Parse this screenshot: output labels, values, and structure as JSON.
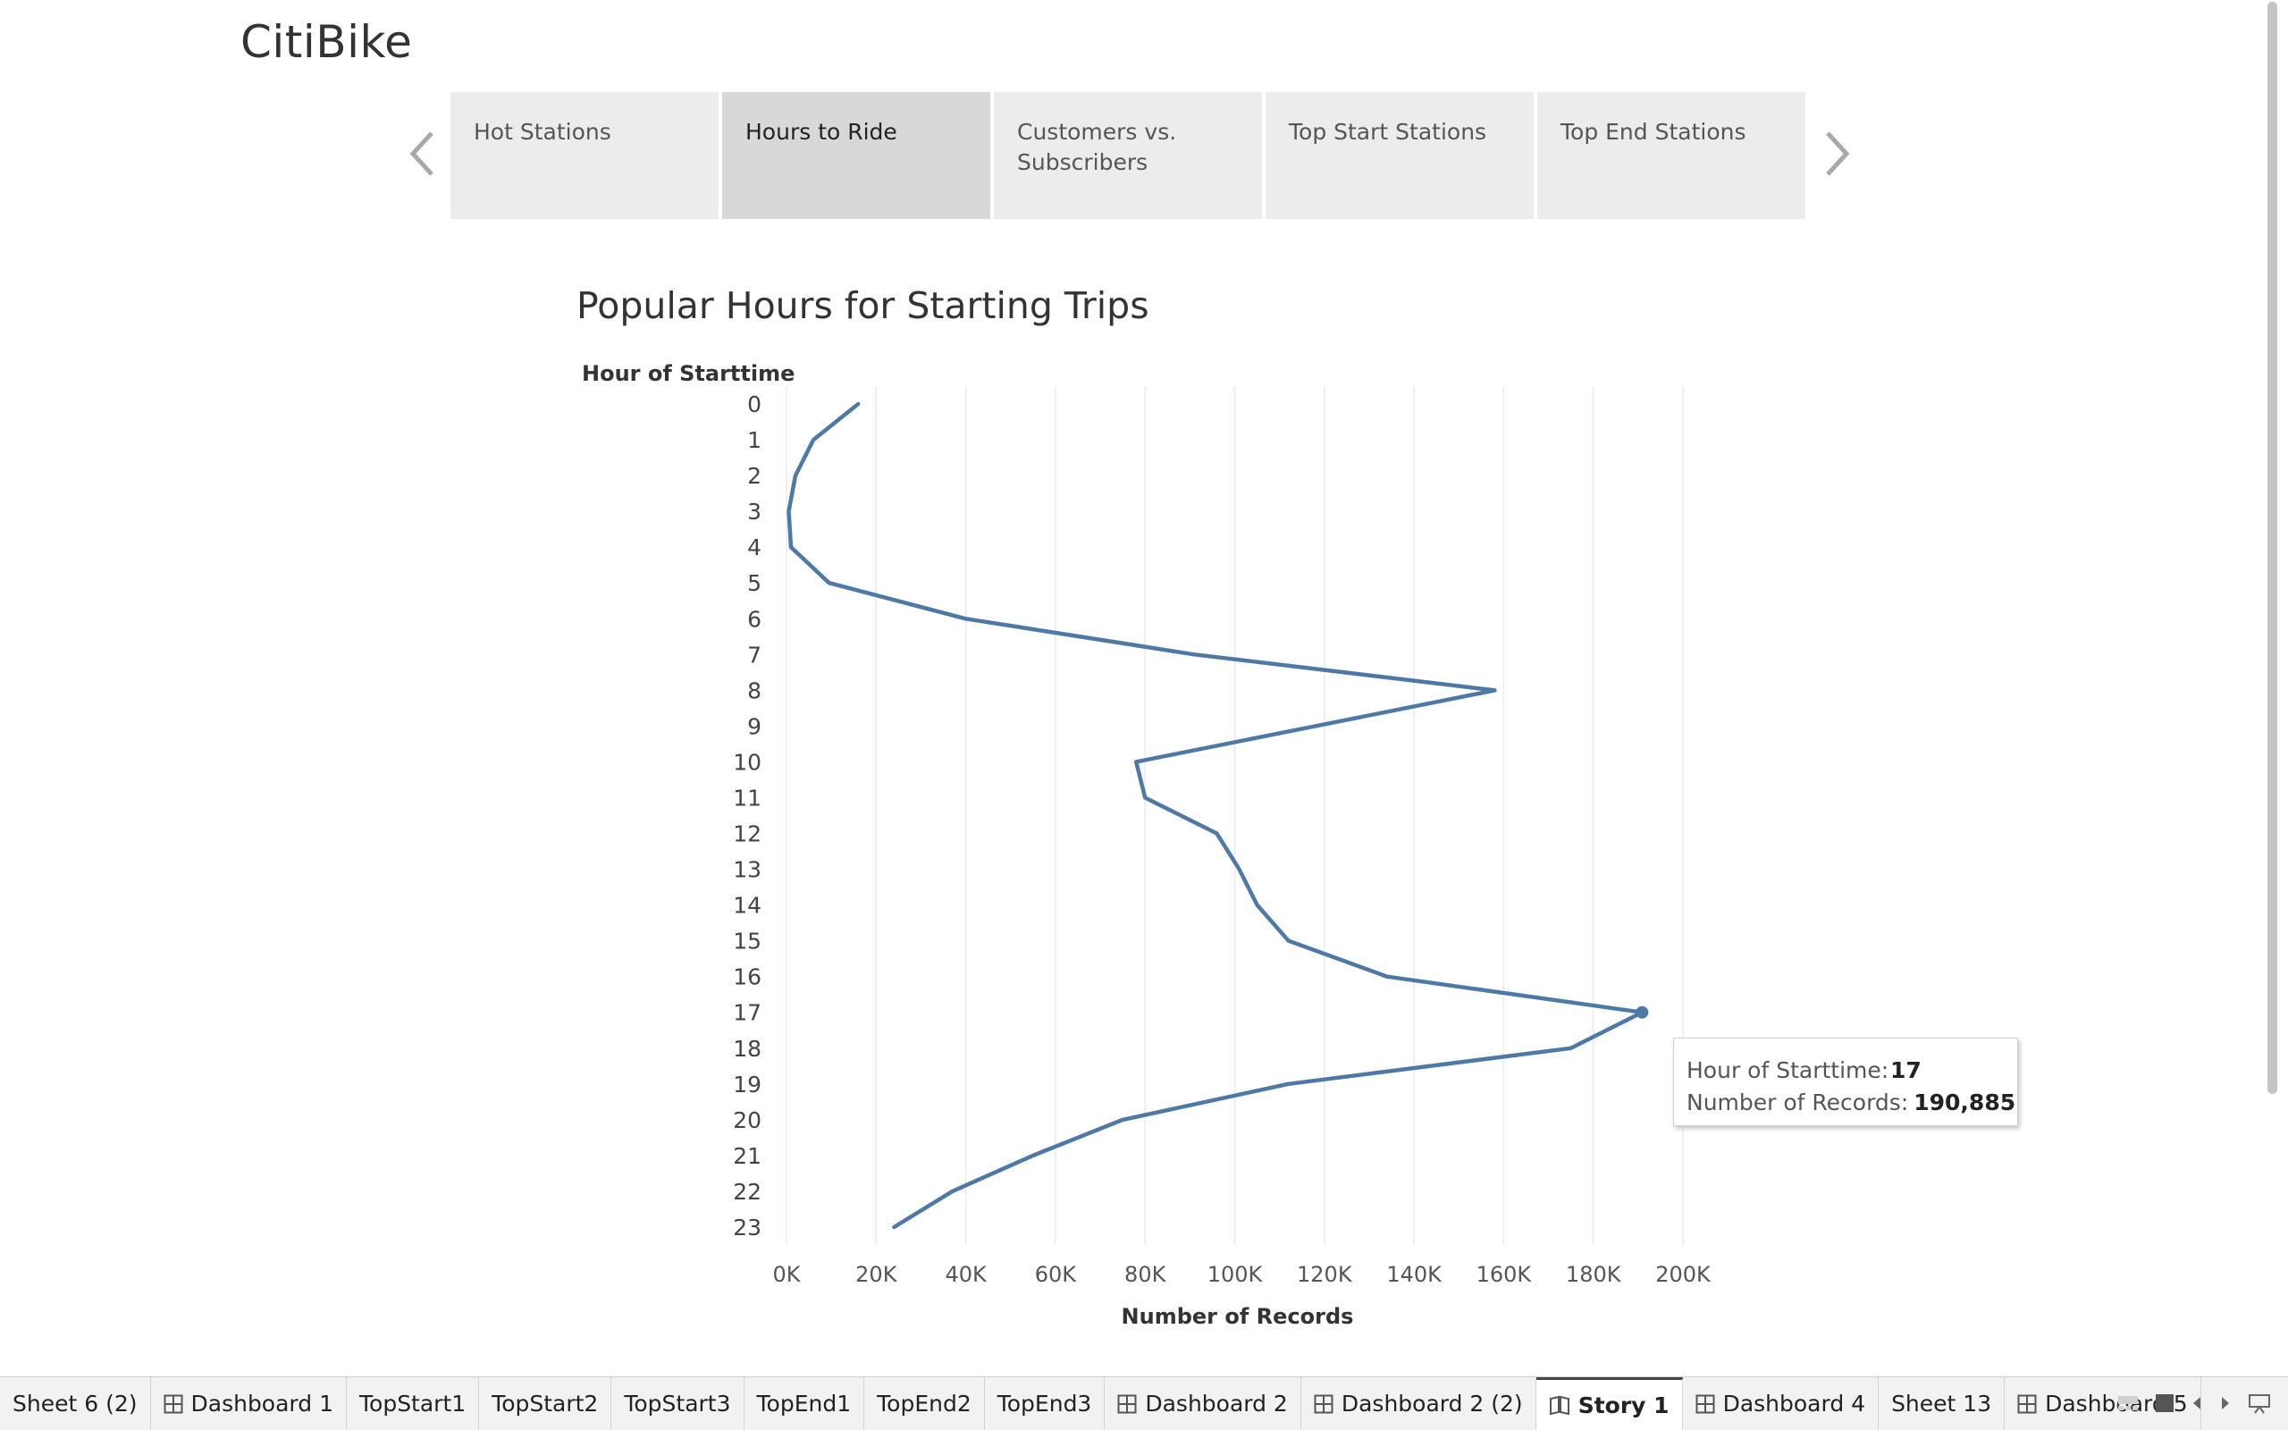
{
  "story": {
    "title": "CitiBike",
    "points": [
      {
        "label": "Hot Stations",
        "active": false
      },
      {
        "label": "Hours to Ride",
        "active": true
      },
      {
        "label": "Customers vs. Subscribers",
        "active": false
      },
      {
        "label": "Top Start Stations",
        "active": false
      },
      {
        "label": "Top End Stations",
        "active": false
      }
    ]
  },
  "chart_data": {
    "type": "line",
    "title": "Popular Hours for Starting Trips",
    "orientation": "horizontal",
    "ylabel": "Hour of Starttime",
    "xlabel": "Number of Records",
    "categories": [
      "0",
      "1",
      "2",
      "3",
      "4",
      "5",
      "6",
      "7",
      "8",
      "9",
      "10",
      "11",
      "12",
      "13",
      "14",
      "15",
      "16",
      "17",
      "18",
      "19",
      "20",
      "21",
      "22",
      "23"
    ],
    "values": [
      16000,
      6000,
      2000,
      500,
      1000,
      9500,
      40000,
      91000,
      158000,
      118000,
      78000,
      80000,
      96000,
      101000,
      105000,
      112000,
      134000,
      190885,
      175000,
      112000,
      75000,
      55000,
      37000,
      24000
    ],
    "xlim": [
      0,
      200000
    ],
    "x_ticks": [
      "0K",
      "20K",
      "40K",
      "60K",
      "80K",
      "100K",
      "120K",
      "140K",
      "160K",
      "180K",
      "200K"
    ],
    "line_color": "#4e79a7",
    "grid": "vertical",
    "highlight": {
      "category": "17",
      "value": 190885
    }
  },
  "tooltip": {
    "row1_label": "Hour of Starttime:",
    "row1_value": "17",
    "row2_label": "Number of Records:",
    "row2_value": "190,885"
  },
  "sheet_tabs": [
    {
      "label": "Sheet 6 (2)",
      "icon": "none"
    },
    {
      "label": "Dashboard 1",
      "icon": "dashboard-icon"
    },
    {
      "label": "TopStart1",
      "icon": "none"
    },
    {
      "label": "TopStart2",
      "icon": "none"
    },
    {
      "label": "TopStart3",
      "icon": "none"
    },
    {
      "label": "TopEnd1",
      "icon": "none"
    },
    {
      "label": "TopEnd2",
      "icon": "none"
    },
    {
      "label": "TopEnd3",
      "icon": "none"
    },
    {
      "label": "Dashboard 2",
      "icon": "dashboard-icon"
    },
    {
      "label": "Dashboard 2 (2)",
      "icon": "dashboard-icon"
    },
    {
      "label": "Story 1",
      "icon": "story-icon",
      "active": true
    },
    {
      "label": "Dashboard 4",
      "icon": "dashboard-icon"
    },
    {
      "label": "Sheet 13",
      "icon": "none"
    },
    {
      "label": "Dashboard 5",
      "icon": "dashboard-icon"
    }
  ],
  "tab_controls": [
    "filmstrip-icon",
    "tabs-icon",
    "scroll-left-icon",
    "scroll-right-icon",
    "presentation-icon"
  ]
}
